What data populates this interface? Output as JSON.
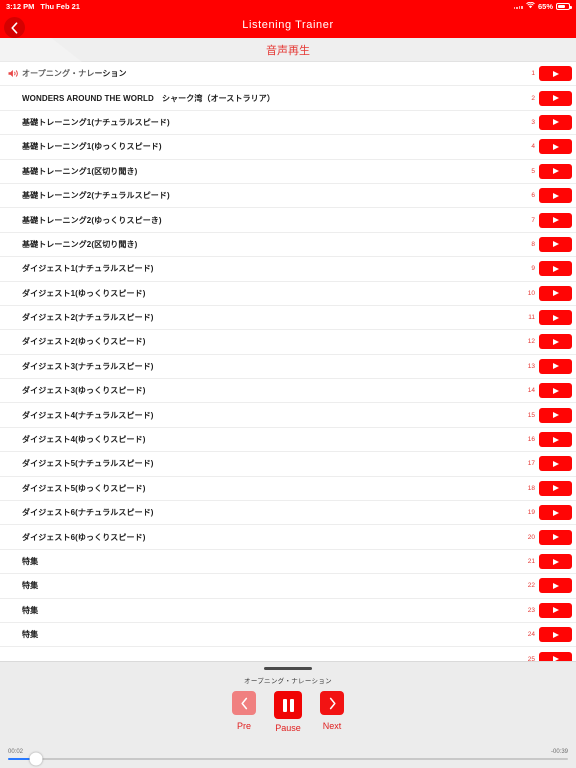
{
  "status_bar": {
    "time": "3:12 PM",
    "date": "Thu Feb 21",
    "battery_percent": "65%",
    "wifi_icon": "wifi-icon",
    "battery_icon": "battery-icon",
    "signal_icon": "signal-icon"
  },
  "nav": {
    "title": "Listening  Trainer",
    "back_icon": "chevron-left-icon"
  },
  "subheader": {
    "title": "音声再生"
  },
  "list": {
    "now_playing_icon": "speaker-icon",
    "play_icon": "play-icon",
    "rows": [
      {
        "num": "1",
        "label": "オープニング・ナレーション",
        "playing": true
      },
      {
        "num": "2",
        "label": "WONDERS AROUND THE WORLD　シャーク湾（オーストラリア）",
        "playing": false
      },
      {
        "num": "3",
        "label": "基礎トレーニング1(ナチュラルスピード)",
        "playing": false
      },
      {
        "num": "4",
        "label": "基礎トレーニング1(ゆっくりスピード)",
        "playing": false
      },
      {
        "num": "5",
        "label": "基礎トレーニング1(区切り聞き)",
        "playing": false
      },
      {
        "num": "6",
        "label": "基礎トレーニング2(ナチュラルスピード)",
        "playing": false
      },
      {
        "num": "7",
        "label": "基礎トレーニング2(ゆっくりスピーき)",
        "playing": false
      },
      {
        "num": "8",
        "label": "基礎トレーニング2(区切り聞き)",
        "playing": false
      },
      {
        "num": "9",
        "label": "ダイジェスト1(ナチュラルスピード)",
        "playing": false
      },
      {
        "num": "10",
        "label": "ダイジェスト1(ゆっくりスピード)",
        "playing": false
      },
      {
        "num": "11",
        "label": "ダイジェスト2(ナチュラルスピード)",
        "playing": false
      },
      {
        "num": "12",
        "label": "ダイジェスト2(ゆっくりスピード)",
        "playing": false
      },
      {
        "num": "13",
        "label": "ダイジェスト3(ナチュラルスピード)",
        "playing": false
      },
      {
        "num": "14",
        "label": "ダイジェスト3(ゆっくりスピード)",
        "playing": false
      },
      {
        "num": "15",
        "label": "ダイジェスト4(ナチュラルスピード)",
        "playing": false
      },
      {
        "num": "16",
        "label": "ダイジェスト4(ゆっくりスピード)",
        "playing": false
      },
      {
        "num": "17",
        "label": "ダイジェスト5(ナチュラルスピード)",
        "playing": false
      },
      {
        "num": "18",
        "label": "ダイジェスト5(ゆっくりスピード)",
        "playing": false
      },
      {
        "num": "19",
        "label": "ダイジェスト6(ナチュラルスピード)",
        "playing": false
      },
      {
        "num": "20",
        "label": "ダイジェスト6(ゆっくりスピード)",
        "playing": false
      },
      {
        "num": "21",
        "label": "特集",
        "playing": false
      },
      {
        "num": "22",
        "label": "特集",
        "playing": false
      },
      {
        "num": "23",
        "label": "特集",
        "playing": false
      },
      {
        "num": "24",
        "label": "特集",
        "playing": false
      },
      {
        "num": "25",
        "label": "",
        "playing": false
      }
    ]
  },
  "player": {
    "now_playing": "オープニング・ナレーション",
    "prev_label": "Pre",
    "play_label": "Pause",
    "next_label": "Next",
    "prev_icon": "chevron-left-icon",
    "pause_icon": "pause-icon",
    "next_icon": "chevron-right-icon",
    "elapsed": "00:02",
    "remaining": "-00:39",
    "progress_percent": 5,
    "grabber_icon": "drag-handle-icon"
  },
  "colors": {
    "brand_red": "#FF0000",
    "button_red": "#FF0505",
    "accent_text_red": "#E53935",
    "disabled_red": "#F08080",
    "progress_blue": "#2979FF",
    "panel_gray": "#ECECEC",
    "subbar_gray": "#EFEFEF"
  }
}
